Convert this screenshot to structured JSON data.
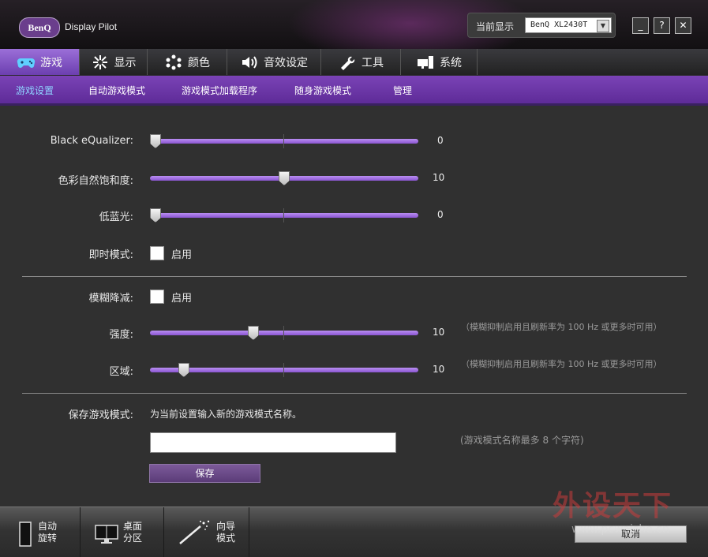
{
  "app": {
    "logo": "BenQ",
    "title": "Display Pilot"
  },
  "monitor": {
    "label": "当前显示",
    "selected": "BenQ XL2430T"
  },
  "window_buttons": {
    "minimize": "_",
    "help": "?",
    "close": "✕"
  },
  "tabs": [
    {
      "label": "游戏",
      "icon": "gamepad-icon",
      "active": true
    },
    {
      "label": "显示",
      "icon": "display-brightness-icon",
      "active": false
    },
    {
      "label": "颜色",
      "icon": "color-dots-icon",
      "active": false
    },
    {
      "label": "音效设定",
      "icon": "speaker-icon",
      "active": false
    },
    {
      "label": "工具",
      "icon": "wrench-icon",
      "active": false
    },
    {
      "label": "系统",
      "icon": "system-monitor-icon",
      "active": false
    }
  ],
  "subtabs": [
    {
      "label": "游戏设置",
      "active": true
    },
    {
      "label": "自动游戏模式",
      "active": false
    },
    {
      "label": "游戏模式加载程序",
      "active": false
    },
    {
      "label": "随身游戏模式",
      "active": false
    },
    {
      "label": "管理",
      "active": false
    }
  ],
  "settings": {
    "black_equalizer": {
      "label": "Black eQualizer:",
      "value": "0",
      "level": 0.0
    },
    "color_vibrance": {
      "label": "色彩自然饱和度:",
      "value": "10",
      "level": 0.5
    },
    "low_blue_light": {
      "label": "低蓝光:",
      "value": "0",
      "level": 0.0
    },
    "instant_mode": {
      "label": "即时模式:",
      "checkbox_label": "启用",
      "checked": false
    },
    "motion_blur_reduction": {
      "label": "模糊降减:",
      "checkbox_label": "启用",
      "checked": false
    },
    "intensity": {
      "label": "强度:",
      "value": "10",
      "level": 0.38,
      "note": "（模糊抑制启用且刷新率为 100 Hz 或更多时可用）"
    },
    "area": {
      "label": "区域:",
      "value": "10",
      "level": 0.11,
      "note": "（模糊抑制启用且刷新率为 100 Hz 或更多时可用）"
    }
  },
  "save_mode": {
    "label": "保存游戏模式:",
    "hint": "为当前设置输入新的游戏模式名称。",
    "input_value": "",
    "limit_note": "(游戏模式名称最多 8 个字符)",
    "save_button": "保存"
  },
  "bottom": {
    "buttons": [
      {
        "line1": "自动",
        "line2": "旋转",
        "icon": "rotate-monitor-icon"
      },
      {
        "line1": "桌面",
        "line2": "分区",
        "icon": "desktop-partition-icon"
      },
      {
        "line1": "向导",
        "line2": "模式",
        "icon": "wizard-wand-icon"
      }
    ],
    "cancel_button": "取消"
  },
  "watermark": {
    "text": "外设天下",
    "url": "www.pcwaishe.cn"
  },
  "colors": {
    "accent": "#7a43b6",
    "subtab_active": "#8fd3ff",
    "slider": "#9a66e0"
  }
}
